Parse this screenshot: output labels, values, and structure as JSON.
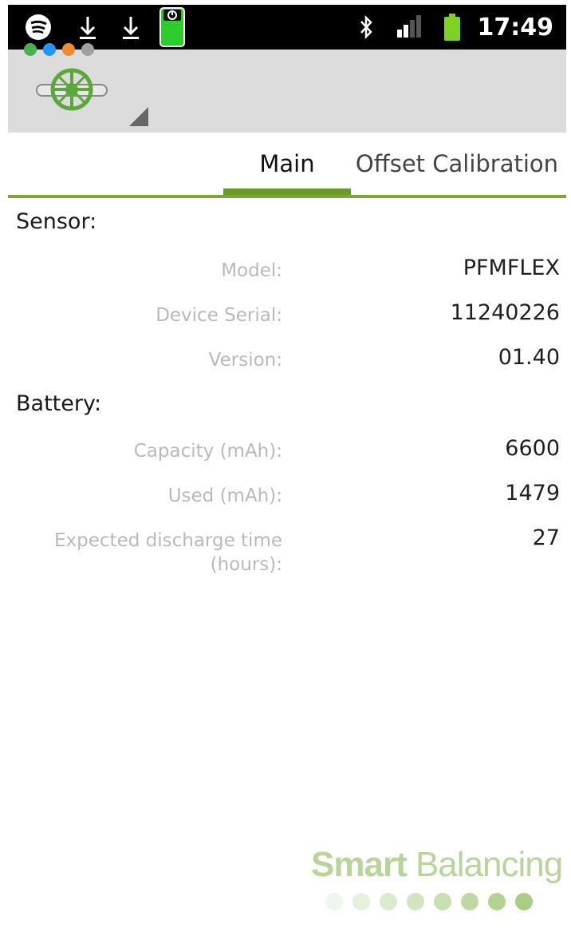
{
  "status_bar": {
    "time": "17:49",
    "icons": [
      "spotify-icon",
      "download-icon",
      "download-icon",
      "device-battery-icon",
      "bluetooth-icon",
      "signal-icon",
      "battery-icon"
    ]
  },
  "action_bar": {
    "logo_icon": "valve-logo-icon",
    "dropdown_icon": "spinner-triangle-icon",
    "dot_colors": [
      "#4caf50",
      "#2196f3",
      "#f08c2e",
      "#a0a0a0"
    ]
  },
  "tabs": [
    {
      "label": "Main",
      "selected": true
    },
    {
      "label": "Offset Calibration",
      "selected": false
    }
  ],
  "sensor": {
    "title": "Sensor:",
    "rows": [
      {
        "label": "Model:",
        "value": "PFMFLEX"
      },
      {
        "label": "Device Serial:",
        "value": "11240226"
      },
      {
        "label": "Version:",
        "value": "01.40"
      }
    ]
  },
  "battery": {
    "title": "Battery:",
    "rows": [
      {
        "label": "Capacity (mAh):",
        "value": "6600"
      },
      {
        "label": "Used (mAh):",
        "value": "1479"
      },
      {
        "label": "Expected discharge time (hours):",
        "value": "27"
      }
    ]
  },
  "branding": {
    "bold": "Smart",
    "light": "Balancing",
    "accent_color": "#8bc34a"
  }
}
